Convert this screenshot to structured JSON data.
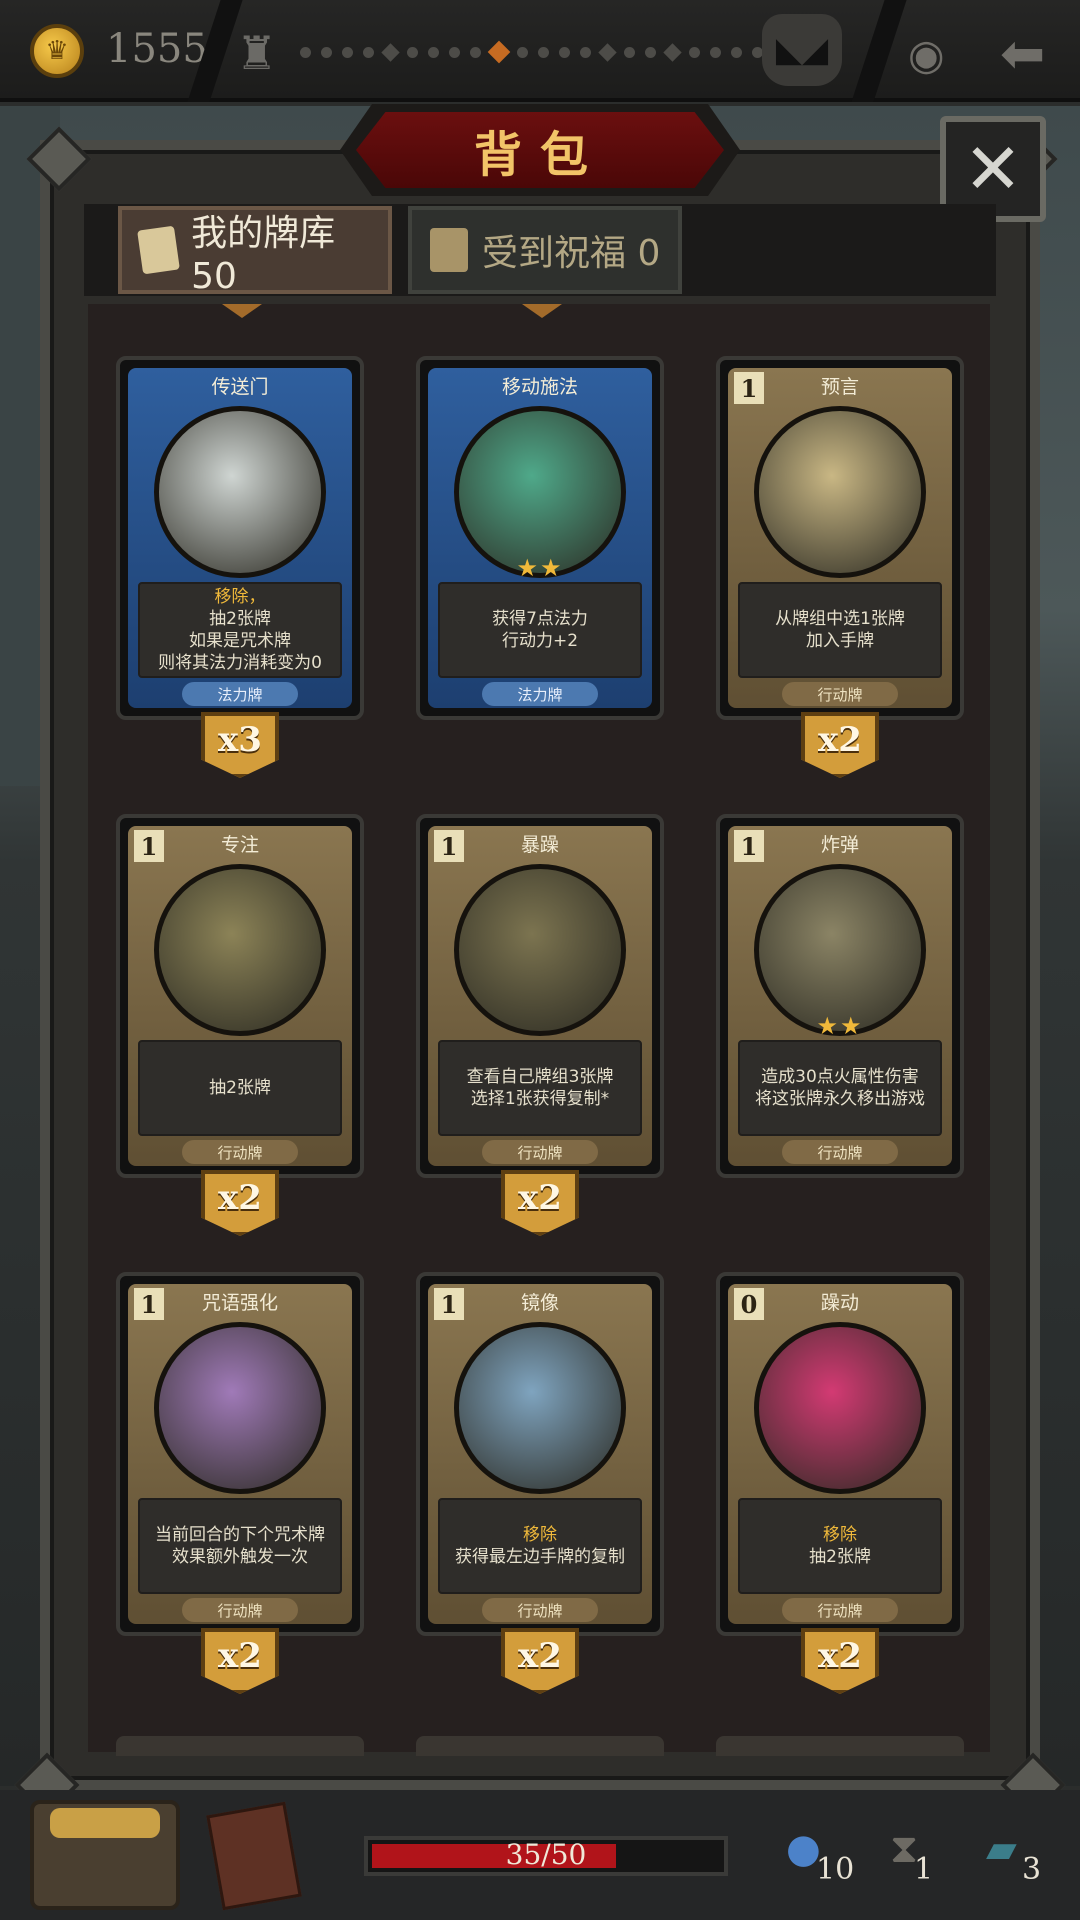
{
  "topbar": {
    "gold": "1555",
    "coin_icon": "crown-coin-icon",
    "map_nodes": [
      "dot",
      "dot",
      "dot",
      "dot",
      "dia",
      "dot",
      "dot",
      "dot",
      "dot",
      "dia-cur",
      "dot",
      "dot",
      "dot",
      "dot",
      "dia",
      "dot",
      "dot",
      "dia",
      "dot",
      "dot",
      "dot",
      "dot",
      "dia",
      "dot",
      "dot"
    ]
  },
  "panel": {
    "title": "背包",
    "close_label": "✕"
  },
  "tabs": [
    {
      "label": "我的牌库 50",
      "active": true
    },
    {
      "label": "受到祝福 0",
      "active": false
    }
  ],
  "cards": [
    {
      "name": "传送门",
      "cost": "",
      "kind": "spell",
      "stars": "",
      "desc_hl": "移除，",
      "desc": "抽2张牌",
      "desc2": "如果是咒术牌",
      "desc3": "则将其法力消耗变为0",
      "type": "法力牌",
      "count": "x3",
      "art": "#cfd5d2"
    },
    {
      "name": "移动施法",
      "cost": "",
      "kind": "spell",
      "stars": "★★",
      "desc_hl": "",
      "desc": "获得7点法力",
      "desc2": "行动力+2",
      "desc3": "",
      "type": "法力牌",
      "count": "",
      "art": "#4fa98a"
    },
    {
      "name": "预言",
      "cost": "1",
      "kind": "action",
      "stars": "",
      "desc_hl": "",
      "desc": "从牌组中选1张牌",
      "desc2": "加入手牌",
      "desc3": "",
      "type": "行动牌",
      "count": "x2",
      "art": "#c9b784"
    },
    {
      "name": "专注",
      "cost": "1",
      "kind": "action",
      "stars": "",
      "desc_hl": "",
      "desc": "抽2张牌",
      "desc2": "",
      "desc3": "",
      "type": "行动牌",
      "count": "x2",
      "art": "#8c8357"
    },
    {
      "name": "暴躁",
      "cost": "1",
      "kind": "action",
      "stars": "",
      "desc_hl": "",
      "desc": "查看自己牌组3张牌",
      "desc2": "选择1张获得复制*",
      "desc3": "",
      "type": "行动牌",
      "count": "x2",
      "art": "#7c7450"
    },
    {
      "name": "炸弹",
      "cost": "1",
      "kind": "action",
      "stars": "★★",
      "desc_hl": "",
      "desc": "造成30点火属性伤害",
      "desc2": "将这张牌永久移出游戏",
      "desc3": "",
      "type": "行动牌",
      "count": "",
      "art": "#8b8465"
    },
    {
      "name": "咒语强化",
      "cost": "1",
      "kind": "action",
      "stars": "",
      "desc_hl": "",
      "desc": "当前回合的下个咒术牌",
      "desc2": "效果额外触发一次",
      "desc3": "",
      "type": "行动牌",
      "count": "x2",
      "art": "#a07ab8"
    },
    {
      "name": "镜像",
      "cost": "1",
      "kind": "action",
      "stars": "",
      "desc_hl": "移除",
      "desc": "获得最左边手牌的复制",
      "desc2": "",
      "desc3": "",
      "type": "行动牌",
      "count": "x2",
      "art": "#7fa4bf"
    },
    {
      "name": "躁动",
      "cost": "0",
      "kind": "action",
      "stars": "",
      "desc_hl": "移除",
      "desc": "抽2张牌",
      "desc2": "",
      "desc3": "",
      "type": "行动牌",
      "count": "x2",
      "art": "#d33a73"
    }
  ],
  "bottombar": {
    "hp_text": "35/50",
    "hp_current": 35,
    "hp_max": 50,
    "mana": "10",
    "turns": "1",
    "cards": "3"
  }
}
